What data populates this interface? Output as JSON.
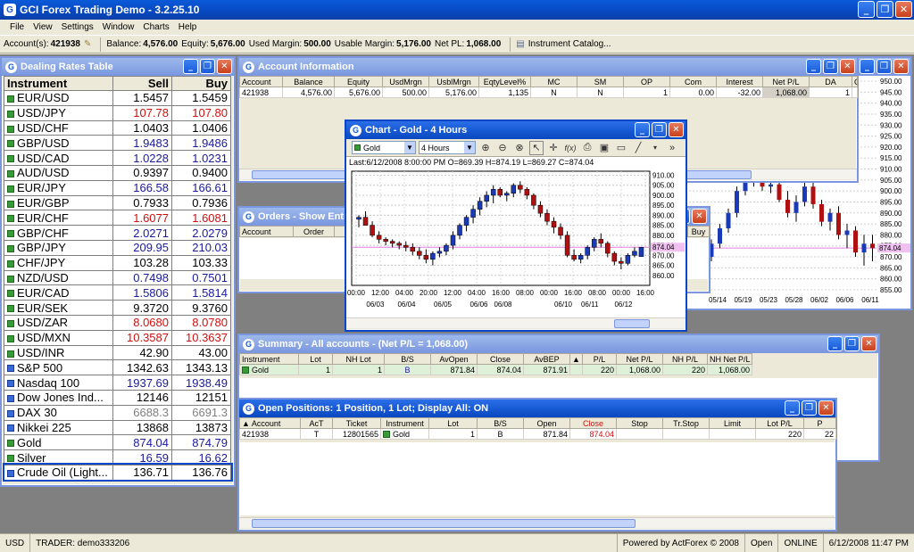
{
  "app": {
    "title": "GCI Forex Trading Demo - 3.2.25.10"
  },
  "menu": [
    "File",
    "View",
    "Settings",
    "Window",
    "Charts",
    "Help"
  ],
  "accountbar": {
    "account_label": "Account(s):",
    "account": "421938",
    "balance_label": "Balance:",
    "balance": "4,576.00",
    "equity_label": "Equity:",
    "equity": "5,676.00",
    "used_margin_label": "Used Margin:",
    "used_margin": "500.00",
    "usable_margin_label": "Usable Margin:",
    "usable_margin": "5,176.00",
    "net_pl_label": "Net PL:",
    "net_pl": "1,068.00",
    "catalog": "Instrument Catalog..."
  },
  "rates": {
    "title": "Dealing Rates Table",
    "headers": [
      "Instrument",
      "Sell",
      "Buy"
    ],
    "rows": [
      {
        "name": "EUR/USD",
        "sell": "1.5457",
        "buy": "1.5459",
        "c": "sv"
      },
      {
        "name": "USD/JPY",
        "sell": "107.78",
        "buy": "107.80",
        "c": "dn"
      },
      {
        "name": "USD/CHF",
        "sell": "1.0403",
        "buy": "1.0406",
        "c": "sv"
      },
      {
        "name": "GBP/USD",
        "sell": "1.9483",
        "buy": "1.9486",
        "c": "up"
      },
      {
        "name": "USD/CAD",
        "sell": "1.0228",
        "buy": "1.0231",
        "c": "up"
      },
      {
        "name": "AUD/USD",
        "sell": "0.9397",
        "buy": "0.9400",
        "c": "sv"
      },
      {
        "name": "EUR/JPY",
        "sell": "166.58",
        "buy": "166.61",
        "c": "up"
      },
      {
        "name": "EUR/GBP",
        "sell": "0.7933",
        "buy": "0.7936",
        "c": "sv"
      },
      {
        "name": "EUR/CHF",
        "sell": "1.6077",
        "buy": "1.6081",
        "c": "dn"
      },
      {
        "name": "GBP/CHF",
        "sell": "2.0271",
        "buy": "2.0279",
        "c": "up"
      },
      {
        "name": "GBP/JPY",
        "sell": "209.95",
        "buy": "210.03",
        "c": "up"
      },
      {
        "name": "CHF/JPY",
        "sell": "103.28",
        "buy": "103.33",
        "c": "sv"
      },
      {
        "name": "NZD/USD",
        "sell": "0.7498",
        "buy": "0.7501",
        "c": "up"
      },
      {
        "name": "EUR/CAD",
        "sell": "1.5806",
        "buy": "1.5814",
        "c": "up"
      },
      {
        "name": "EUR/SEK",
        "sell": "9.3720",
        "buy": "9.3760",
        "c": "sv"
      },
      {
        "name": "USD/ZAR",
        "sell": "8.0680",
        "buy": "8.0780",
        "c": "dn"
      },
      {
        "name": "USD/MXN",
        "sell": "10.3587",
        "buy": "10.3637",
        "c": "dn"
      },
      {
        "name": "USD/INR",
        "sell": "42.90",
        "buy": "43.00",
        "c": "sv"
      },
      {
        "name": "S&P 500",
        "sell": "1342.63",
        "buy": "1343.13",
        "c": "sv"
      },
      {
        "name": "Nasdaq 100",
        "sell": "1937.69",
        "buy": "1938.49",
        "c": "up"
      },
      {
        "name": "Dow Jones Ind...",
        "sell": "12146",
        "buy": "12151",
        "c": "sv"
      },
      {
        "name": "DAX 30",
        "sell": "6688.3",
        "buy": "6691.3",
        "c": "gr"
      },
      {
        "name": "Nikkei 225",
        "sell": "13868",
        "buy": "13873",
        "c": "sv"
      },
      {
        "name": "Gold",
        "sell": "874.04",
        "buy": "874.79",
        "c": "up"
      },
      {
        "name": "Silver",
        "sell": "16.59",
        "buy": "16.62",
        "c": "up"
      },
      {
        "name": "Crude Oil (Light...",
        "sell": "136.71",
        "buy": "136.76",
        "c": "sv"
      }
    ]
  },
  "account_info": {
    "title": "Account Information",
    "headers": [
      "Account",
      "Balance",
      "Equity",
      "UsdMrgn",
      "UsblMrgn",
      "EqtyLevel%",
      "MC",
      "SM",
      "OP",
      "Com",
      "Interest",
      "Net P/L",
      "DA",
      "Gr"
    ],
    "row": [
      "421938",
      "4,576.00",
      "5,676.00",
      "500.00",
      "5,176.00",
      "1,135",
      "N",
      "N",
      "1",
      "0.00",
      "-32.00",
      "1,068.00",
      "1",
      ""
    ]
  },
  "orders": {
    "title": "Orders - Show Entry",
    "headers": [
      "Account",
      "Order",
      "",
      "Buy"
    ]
  },
  "chart": {
    "title": "Chart - Gold - 4 Hours",
    "instrument": "Gold",
    "period": "4 Hours",
    "info": "Last:6/12/2008 8:00:00 PM O=869.39 H=874.19 L=869.27 C=874.04",
    "price_tag": "874.04"
  },
  "chart_data": {
    "type": "candlestick",
    "title": "Chart - Gold - 4 Hours",
    "ylim": [
      855,
      912
    ],
    "yticks": [
      "910.00",
      "905.00",
      "900.00",
      "895.00",
      "890.00",
      "885.00",
      "880.00",
      "875.00",
      "870.00",
      "865.00",
      "860.00"
    ],
    "yvals": [
      910,
      905,
      900,
      895,
      890,
      885,
      880,
      875,
      870,
      865,
      860
    ],
    "xticks_top": [
      "00:00",
      "12:00",
      "04:00",
      "20:00",
      "12:00",
      "04:00",
      "16:00",
      "08:00",
      "00:00",
      "16:00",
      "08:00",
      "00:00",
      "16:00"
    ],
    "xticks_bottom": [
      "06/03",
      "06/04",
      "06/05",
      "06/06",
      "06/08",
      "06/10",
      "06/11",
      "06/12"
    ],
    "candles": [
      [
        888,
        890,
        884,
        889
      ],
      [
        889,
        892,
        886,
        885
      ],
      [
        885,
        887,
        879,
        880
      ],
      [
        880,
        882,
        876,
        878
      ],
      [
        878,
        879,
        875,
        877
      ],
      [
        877,
        878,
        874,
        876
      ],
      [
        876,
        877,
        873,
        875
      ],
      [
        875,
        877,
        872,
        874
      ],
      [
        874,
        876,
        870,
        872
      ],
      [
        872,
        874,
        868,
        870
      ],
      [
        870,
        873,
        866,
        868
      ],
      [
        868,
        872,
        865,
        871
      ],
      [
        871,
        874,
        869,
        872
      ],
      [
        872,
        876,
        870,
        875
      ],
      [
        875,
        882,
        873,
        880
      ],
      [
        880,
        886,
        878,
        885
      ],
      [
        885,
        890,
        882,
        889
      ],
      [
        889,
        895,
        886,
        893
      ],
      [
        893,
        899,
        890,
        897
      ],
      [
        897,
        902,
        894,
        900
      ],
      [
        900,
        905,
        896,
        903
      ],
      [
        903,
        904,
        899,
        900
      ],
      [
        900,
        902,
        897,
        901
      ],
      [
        901,
        906,
        899,
        905
      ],
      [
        905,
        907,
        901,
        903
      ],
      [
        903,
        904,
        898,
        900
      ],
      [
        900,
        901,
        893,
        895
      ],
      [
        895,
        897,
        889,
        891
      ],
      [
        891,
        893,
        885,
        887
      ],
      [
        887,
        889,
        881,
        884
      ],
      [
        884,
        886,
        878,
        880
      ],
      [
        880,
        882,
        869,
        870
      ],
      [
        870,
        873,
        867,
        868
      ],
      [
        868,
        871,
        866,
        870
      ],
      [
        870,
        875,
        868,
        874
      ],
      [
        874,
        879,
        872,
        878
      ],
      [
        878,
        881,
        874,
        876
      ],
      [
        876,
        877,
        869,
        871
      ],
      [
        871,
        872,
        865,
        867
      ],
      [
        867,
        869,
        863,
        866
      ],
      [
        866,
        871,
        865,
        870
      ],
      [
        870,
        874,
        869,
        872
      ],
      [
        869.39,
        874.19,
        869.27,
        874.04
      ]
    ]
  },
  "background_chart": {
    "yticks": [
      "950.00",
      "945.00",
      "940.00",
      "935.00",
      "930.00",
      "925.00",
      "920.00",
      "915.00",
      "910.00",
      "905.00",
      "900.00",
      "895.00",
      "890.00",
      "885.00",
      "880.00",
      "875.00",
      "870.00",
      "865.00",
      "860.00",
      "855.00"
    ],
    "xticks": [
      "05/14",
      "05/19",
      "05/23",
      "05/28",
      "06/02",
      "06/06",
      "06/11"
    ],
    "price_tag": "874.04"
  },
  "summary": {
    "title": "Summary - All accounts - (Net P/L = 1,068.00)",
    "headers": [
      "Instrument",
      "Lot",
      "NH Lot",
      "B/S",
      "AvOpen",
      "Close",
      "AvBEP",
      "▲",
      "P/L",
      "Net P/L",
      "NH P/L",
      "NH Net P/L"
    ],
    "row": [
      "Gold",
      "1",
      "1",
      "B",
      "871.84",
      "874.04",
      "871.91",
      "",
      "220",
      "1,068.00",
      "220",
      "1,068.00"
    ]
  },
  "open_positions": {
    "title": "Open Positions: 1 Position, 1 Lot; Display All: ON",
    "headers": [
      "▲ Account",
      "AcT",
      "Ticket",
      "Instrument",
      "Lot",
      "B/S",
      "Open",
      "Close",
      "Stop",
      "Tr.Stop",
      "Limit",
      "Lot P/L",
      "P"
    ],
    "row": [
      "421938",
      "T",
      "12801565",
      "Gold",
      "1",
      "B",
      "871.84",
      "874.04",
      "",
      "",
      "",
      "220",
      "22"
    ]
  },
  "status": {
    "currency": "USD",
    "trader": "TRADER: demo333206",
    "powered": "Powered by ActForex © 2008",
    "market": "Open",
    "connection": "ONLINE",
    "datetime": "6/12/2008 11:47 PM"
  },
  "colors": {
    "title_active": "#0848c0",
    "title_inactive": "#7a96df",
    "up_candle": "#1a3ab8",
    "down_candle": "#b01010",
    "price_line": "#e080e0"
  }
}
